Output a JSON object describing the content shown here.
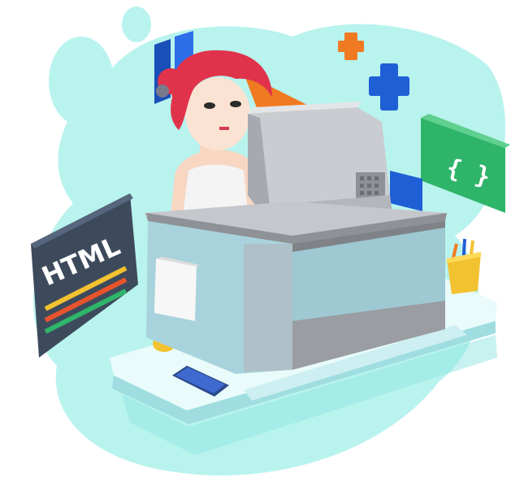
{
  "illustration": {
    "html_card": {
      "text": "HTML"
    },
    "code_card": {
      "text": "{ }"
    }
  },
  "colors": {
    "blob": "#b9f3ee",
    "blob_dark": "#8fe6df",
    "html_card": "#3d4a5c",
    "code_card": "#2fb56a",
    "blue_shape": "#1f5fd6",
    "orange_shape": "#f07a22",
    "monitor": "#c9ccd1",
    "desk_box": "#a8d3dc",
    "hair": "#e0334b"
  },
  "icons": [
    "html-card-icon",
    "braces-card-icon",
    "plus-icon",
    "pencil-cup-icon",
    "phone-icon",
    "mouse-icon"
  ]
}
